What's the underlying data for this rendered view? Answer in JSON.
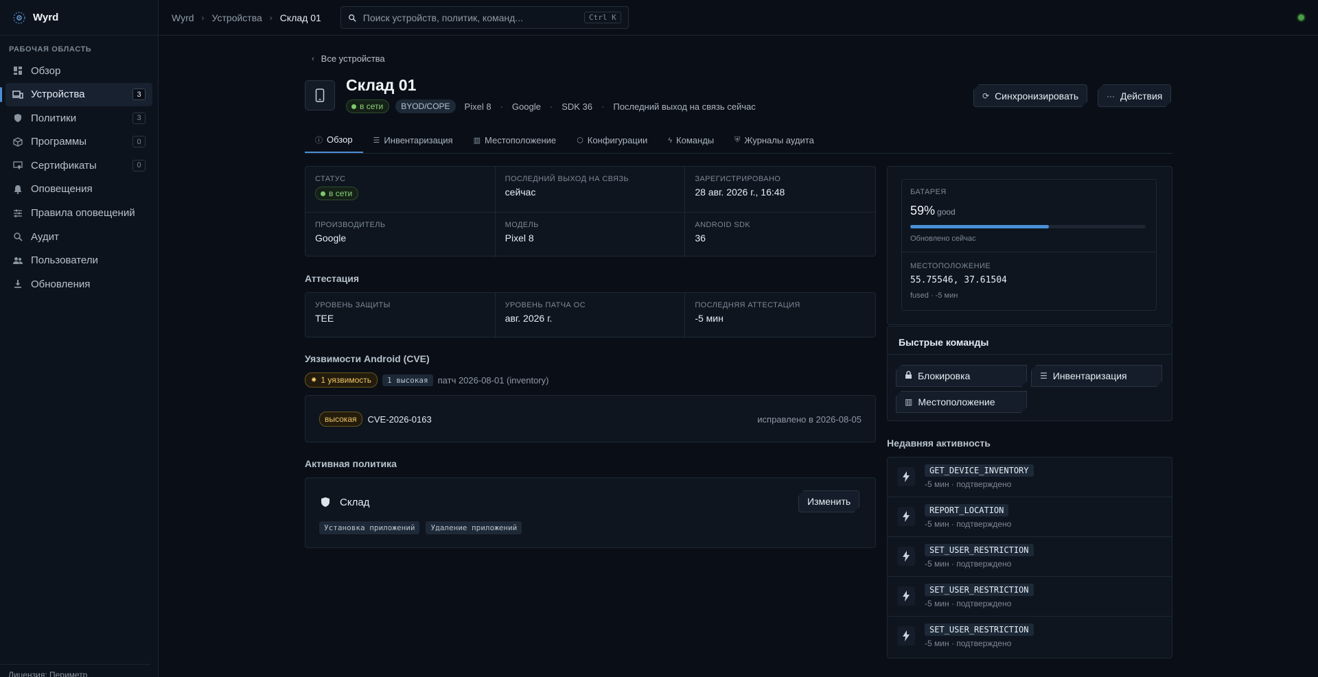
{
  "app": {
    "name": "Wyrd"
  },
  "sidebar": {
    "section_label": "РАБОЧАЯ ОБЛАСТЬ",
    "items": [
      {
        "label": "Обзор",
        "icon": "dashboard-icon",
        "count": ""
      },
      {
        "label": "Устройства",
        "icon": "devices-icon",
        "count": "3"
      },
      {
        "label": "Политики",
        "icon": "shield-icon",
        "count": "3"
      },
      {
        "label": "Программы",
        "icon": "package-icon",
        "count": "0"
      },
      {
        "label": "Сертификаты",
        "icon": "certificate-icon",
        "count": "0"
      },
      {
        "label": "Оповещения",
        "icon": "bell-icon",
        "count": ""
      },
      {
        "label": "Правила оповещений",
        "icon": "sliders-icon",
        "count": ""
      },
      {
        "label": "Аудит",
        "icon": "search-icon",
        "count": ""
      },
      {
        "label": "Пользователи",
        "icon": "users-icon",
        "count": ""
      },
      {
        "label": "Обновления",
        "icon": "download-icon",
        "count": ""
      }
    ],
    "license": "Лицензия: Периметр"
  },
  "topbar": {
    "breadcrumbs": [
      "Wyrd",
      "Устройства",
      "Склад 01"
    ],
    "search_placeholder": "Поиск устройств, политик, команд...",
    "search_shortcut": "Ctrl K"
  },
  "device": {
    "back_label": "Все устройства",
    "title_bold": "Склад",
    "title_rest": " 01",
    "status": "в сети",
    "ownership": "BYOD/COPE",
    "model": "Pixel 8",
    "manufacturer": "Google",
    "sdk": "SDK 36",
    "last_seen": "Последний выход на связь сейчас",
    "sync_label": "Синхронизировать",
    "actions_label": "Действия"
  },
  "tabs": [
    {
      "label": "Обзор",
      "icon": "info-icon"
    },
    {
      "label": "Инвентаризация",
      "icon": "list-icon"
    },
    {
      "label": "Местоположение",
      "icon": "map-icon"
    },
    {
      "label": "Конфигурации",
      "icon": "cube-icon"
    },
    {
      "label": "Команды",
      "icon": "bolt-icon"
    },
    {
      "label": "Журналы аудита",
      "icon": "shield-icon"
    }
  ],
  "overview": {
    "status_label": "СТАТУС",
    "status_value": "в сети",
    "last_seen_label": "ПОСЛЕДНИЙ ВЫХОД НА СВЯЗЬ",
    "last_seen_value": "сейчас",
    "enrolled_label": "ЗАРЕГИСТРИРОВАНО",
    "enrolled_value": "28 авг. 2026 г., 16:48",
    "manufacturer_label": "ПРОИЗВОДИТЕЛЬ",
    "manufacturer_value": "Google",
    "model_label": "МОДЕЛЬ",
    "model_value": "Pixel 8",
    "sdk_label": "ANDROID SDK",
    "sdk_value": "36"
  },
  "attestation": {
    "heading": "Аттестация",
    "security_label": "УРОВЕНЬ ЗАЩИТЫ",
    "security_value": "TEE",
    "patch_label": "УРОВЕНЬ ПАТЧА ОС",
    "patch_value": "авг. 2026 г.",
    "last_label": "ПОСЛЕДНЯЯ АТТЕСТАЦИЯ",
    "last_value": "-5 мин"
  },
  "cve": {
    "heading": "Уязвимости Android (CVE)",
    "count_label": "1 уязвимость",
    "high_label": "1 высокая",
    "patch_label": "патч 2026-08-01 (inventory)",
    "items": [
      {
        "severity": "высокая",
        "id": "CVE-2026-0163",
        "status": "исправлено в 2026-08-05"
      }
    ]
  },
  "policy": {
    "heading": "Активная политика",
    "name": "Склад",
    "edit_label": "Изменить",
    "chips": [
      "Установка приложений",
      "Удаление приложений"
    ]
  },
  "battery": {
    "label": "БАТАРЕЯ",
    "value": "59%",
    "level": 0.59,
    "state": "good",
    "updated": "Обновлено сейчас",
    "bar_color": "#4b8fd6"
  },
  "location": {
    "label": "МЕСТОПОЛОЖЕНИЕ",
    "coords": "55.75546, 37.61504",
    "source": "fused · -5 мин"
  },
  "quick": {
    "heading": "Быстрые команды",
    "lock": "Блокировка",
    "inventory": "Инвентаризация",
    "location": "Местоположение"
  },
  "activity": {
    "heading": "Недавняя активность",
    "items": [
      {
        "command": "GET_DEVICE_INVENTORY",
        "meta": "-5 мин · подтверждено"
      },
      {
        "command": "REPORT_LOCATION",
        "meta": "-5 мин · подтверждено"
      },
      {
        "command": "SET_USER_RESTRICTION",
        "meta": "-5 мин · подтверждено"
      },
      {
        "command": "SET_USER_RESTRICTION",
        "meta": "-5 мин · подтверждено"
      },
      {
        "command": "SET_USER_RESTRICTION",
        "meta": "-5 мин · подтверждено"
      }
    ]
  }
}
